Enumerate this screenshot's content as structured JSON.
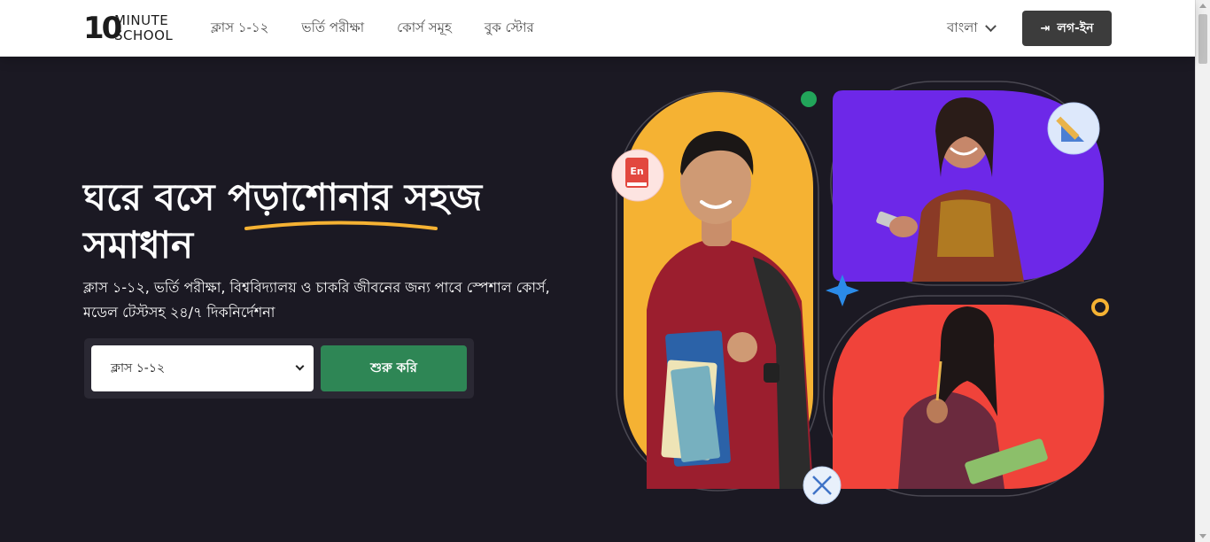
{
  "header": {
    "logo": {
      "ten": "10",
      "line1": "MINUTE",
      "line2": "SCHOOL"
    },
    "nav": [
      "ক্লাস ১-১২",
      "ভর্তি পরীক্ষা",
      "কোর্স সমূহ",
      "বুক স্টোর"
    ],
    "language": "বাংলা",
    "login_label": "লগ-ইন"
  },
  "hero": {
    "headline_line1_a": "ঘরে বসে ",
    "headline_line1_b": "পড়াশোনার",
    "headline_line1_c": " সহজ",
    "headline_line2": "সমাধান",
    "subtitle": "ক্লাস ১-১২, ভর্তি পরীক্ষা, বিশ্ববিদ্যালয় ও চাকরি জীবনের জন্য পাবে স্পেশাল কোর্স, মডেল টেস্টসহ ২৪/৭ দিকনির্দেশনা",
    "select_value": "ক্লাস ১-১২",
    "start_label": "শুরু করি"
  },
  "illustration": {
    "badge_text": "En",
    "colors": {
      "yellow": "#f5b233",
      "purple": "#6d28e8",
      "red": "#f0433a",
      "accent_green": "#22a55a",
      "dark_bg": "#1b1923",
      "button_green": "#2e8655"
    },
    "icons": [
      "book-en-icon",
      "ruler-pencil-icon",
      "sparkle-icon",
      "dna-icon",
      "ring-icon",
      "dot-icon"
    ]
  }
}
